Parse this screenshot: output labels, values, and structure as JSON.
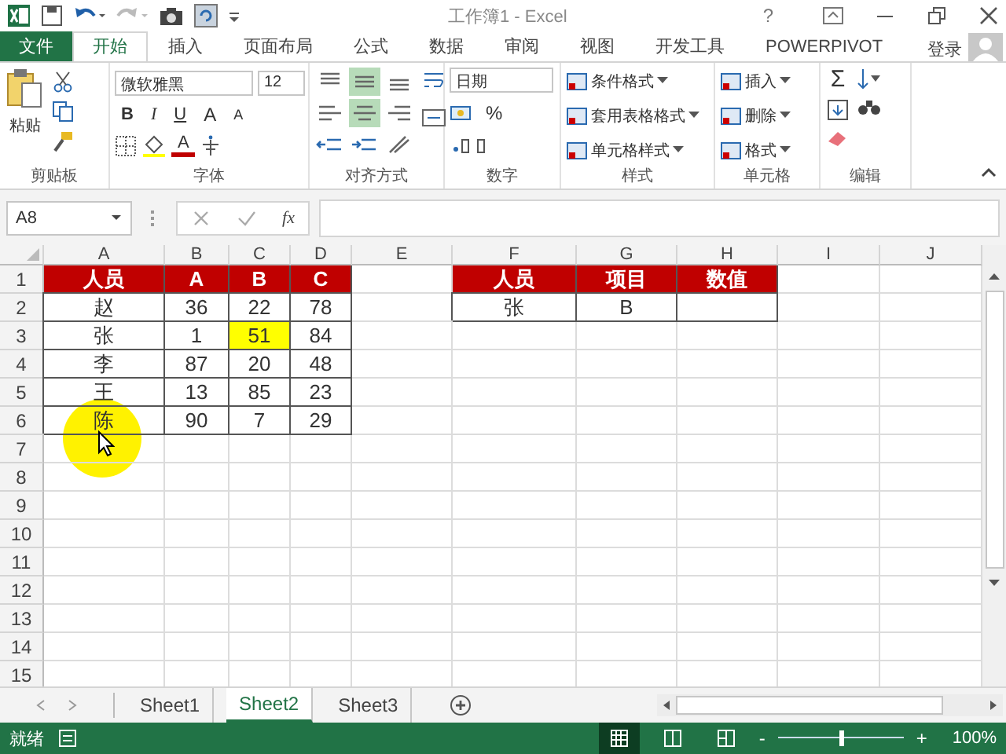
{
  "window": {
    "title": "工作簿1 - Excel",
    "help": "?"
  },
  "tabs": [
    {
      "label": "文件",
      "kind": "file",
      "selected": false
    },
    {
      "label": "开始",
      "kind": "tab",
      "selected": true
    },
    {
      "label": "插入",
      "kind": "tab",
      "selected": false
    },
    {
      "label": "页面布局",
      "kind": "tab",
      "selected": false
    },
    {
      "label": "公式",
      "kind": "tab",
      "selected": false
    },
    {
      "label": "数据",
      "kind": "tab",
      "selected": false
    },
    {
      "label": "审阅",
      "kind": "tab",
      "selected": false
    },
    {
      "label": "视图",
      "kind": "tab",
      "selected": false
    },
    {
      "label": "开发工具",
      "kind": "tab",
      "selected": false
    },
    {
      "label": "POWERPIVOT",
      "kind": "tab",
      "selected": false
    }
  ],
  "sign_in": "登录",
  "ribbon": {
    "groups": [
      {
        "kind": "clipboard",
        "label": "剪贴板",
        "paste": "粘贴"
      },
      {
        "kind": "font",
        "label": "字体",
        "font_name": "微软雅黑",
        "font_size": "12",
        "styles": [
          "B",
          "I",
          "U"
        ],
        "grow": "A",
        "shrink": "A",
        "font_color": "A"
      },
      {
        "kind": "align",
        "label": "对齐方式",
        "buttons": [
          {
            "selected": false
          },
          {
            "selected": true
          },
          {
            "selected": false
          },
          {
            "selected": false
          },
          {
            "selected": true
          },
          {
            "selected": false
          }
        ]
      },
      {
        "kind": "number",
        "label": "数字",
        "format": "日期",
        "percent": "%"
      },
      {
        "kind": "list",
        "label": "样式",
        "items": [
          "条件格式",
          "套用表格格式",
          "单元格样式"
        ]
      },
      {
        "kind": "list",
        "label": "单元格",
        "items": [
          "插入",
          "删除",
          "格式"
        ]
      },
      {
        "kind": "edit",
        "label": "编辑",
        "sum": "Σ"
      }
    ]
  },
  "formula_bar": {
    "name_box": "A8",
    "function": "fx"
  },
  "sheet": {
    "columns": [
      "A",
      "B",
      "C",
      "D",
      "E",
      "F",
      "G",
      "H",
      "I",
      "J"
    ],
    "rows": [
      {
        "number": "1",
        "cells": [
          {
            "kind": "header",
            "value": "人员"
          },
          {
            "kind": "header",
            "value": "A"
          },
          {
            "kind": "header",
            "value": "B"
          },
          {
            "kind": "header",
            "value": "C"
          },
          {},
          {
            "kind": "header",
            "value": "人员"
          },
          {
            "kind": "header",
            "value": "项目"
          },
          {
            "kind": "header",
            "value": "数值"
          },
          {},
          {}
        ]
      },
      {
        "number": "2",
        "cells": [
          {
            "kind": "data",
            "value": "赵"
          },
          {
            "kind": "data",
            "value": "36"
          },
          {
            "kind": "data",
            "value": "22"
          },
          {
            "kind": "data",
            "value": "78"
          },
          {},
          {
            "kind": "data",
            "value": "张"
          },
          {
            "kind": "data",
            "value": "B"
          },
          {
            "kind": "data"
          },
          {},
          {}
        ]
      },
      {
        "number": "3",
        "cells": [
          {
            "kind": "data",
            "value": "张"
          },
          {
            "kind": "data",
            "value": "1"
          },
          {
            "kind": "highlight",
            "value": "51"
          },
          {
            "kind": "data",
            "value": "84"
          },
          {},
          {},
          {},
          {},
          {},
          {}
        ]
      },
      {
        "number": "4",
        "cells": [
          {
            "kind": "data",
            "value": "李"
          },
          {
            "kind": "data",
            "value": "87"
          },
          {
            "kind": "data",
            "value": "20"
          },
          {
            "kind": "data",
            "value": "48"
          },
          {},
          {},
          {},
          {},
          {},
          {}
        ]
      },
      {
        "number": "5",
        "cells": [
          {
            "kind": "data",
            "value": "王"
          },
          {
            "kind": "data",
            "value": "13"
          },
          {
            "kind": "data",
            "value": "85"
          },
          {
            "kind": "data",
            "value": "23"
          },
          {},
          {},
          {},
          {},
          {},
          {}
        ]
      },
      {
        "number": "6",
        "cells": [
          {
            "kind": "data",
            "value": "陈"
          },
          {
            "kind": "data",
            "value": "90"
          },
          {
            "kind": "data",
            "value": "7"
          },
          {
            "kind": "data",
            "value": "29"
          },
          {},
          {},
          {},
          {},
          {},
          {}
        ]
      },
      {
        "number": "7"
      },
      {
        "number": "8"
      },
      {
        "number": "9"
      },
      {
        "number": "10"
      },
      {
        "number": "11"
      },
      {
        "number": "12"
      },
      {
        "number": "13"
      },
      {
        "number": "14"
      },
      {
        "number": "15"
      }
    ]
  },
  "sheet_tabs": [
    {
      "label": "Sheet1",
      "selected": false
    },
    {
      "label": "Sheet2",
      "selected": true
    },
    {
      "label": "Sheet3",
      "selected": false
    }
  ],
  "status_bar": {
    "status": "就绪",
    "views": [
      {
        "selected": true
      },
      {
        "selected": false
      },
      {
        "selected": false
      }
    ],
    "zoom_out": "-",
    "zoom_in": "+",
    "zoom": {
      "level": 0.5
    },
    "zoom_label": "100%"
  }
}
